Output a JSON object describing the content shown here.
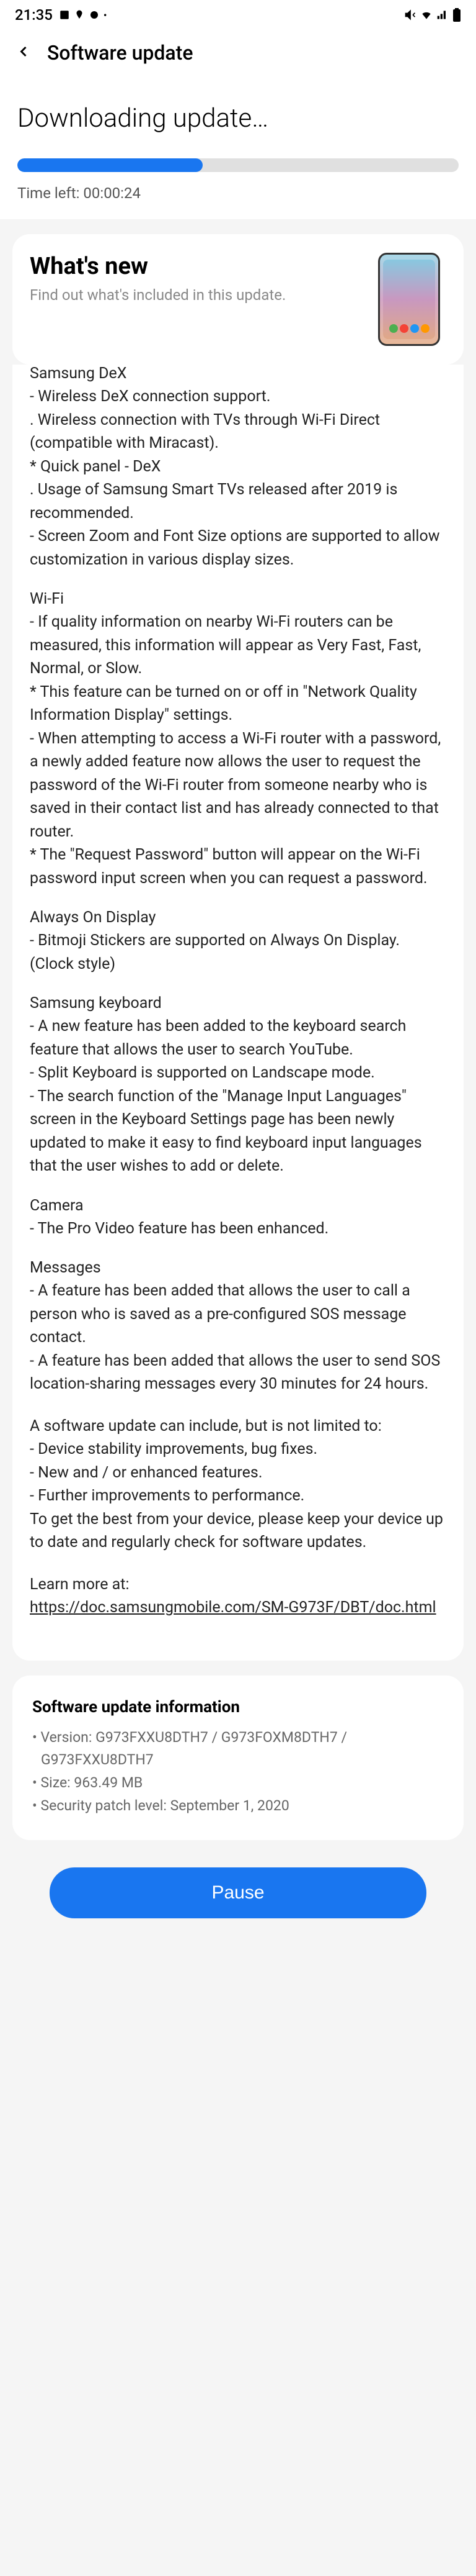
{
  "status": {
    "time": "21:35",
    "left_icons": "🖼 ☁ ⚙ •",
    "right_icons": "🔕 📶 📊 🔋"
  },
  "header": {
    "title": "Software update"
  },
  "download": {
    "title": "Downloading update…",
    "time_left": "Time left: 00:00:24",
    "progress_percent": 42
  },
  "whats_new": {
    "title": "What's new",
    "subtitle": "Find out what's included in this update."
  },
  "sections": [
    {
      "title": "Samsung DeX",
      "items": [
        " - Wireless DeX connection support.",
        "  . Wireless connection with TVs through Wi-Fi Direct (compatible with Miracast).",
        " * Quick panel - DeX",
        "  . Usage of Samsung Smart TVs released after 2019 is recommended.",
        " - Screen Zoom and Font Size options are supported to allow customization in various display sizes."
      ]
    },
    {
      "title": "Wi-Fi",
      "items": [
        " - If quality information on nearby Wi-Fi routers can be measured, this information will appear as Very Fast, Fast, Normal, or Slow.",
        "  * This feature can be turned on or off in \"Network Quality Information Display\" settings.",
        " - When attempting to access a Wi-Fi router with a password, a newly added feature now allows the user to request the password of the Wi-Fi router from someone nearby who is saved in their contact list and has already connected to that router.",
        "  * The \"Request Password\" button will appear on the Wi-Fi password input screen when you can request a password."
      ]
    },
    {
      "title": "Always On Display",
      "items": [
        " - Bitmoji Stickers are supported on Always On Display. (Clock style)"
      ]
    },
    {
      "title": "Samsung keyboard",
      "items": [
        " - A new feature has been added to the keyboard search feature that allows the user to search YouTube.",
        " - Split Keyboard is supported on Landscape mode.",
        " - The search function of the \"Manage Input Languages\" screen in the Keyboard Settings page has been newly updated to make it easy to find keyboard input languages that the user wishes to add or delete."
      ]
    },
    {
      "title": "Camera",
      "items": [
        " - The Pro Video feature has been enhanced."
      ]
    },
    {
      "title": "Messages",
      "items": [
        " - A feature has been added that allows the user to call a person who is saved as a pre-configured SOS message contact.",
        " - A feature has been added that allows the user to send SOS location-sharing messages every 30 minutes for 24 hours."
      ]
    },
    {
      "title": "",
      "items": [
        "A software update can include, but is not limited to:",
        "  - Device stability improvements, bug fixes.",
        "  - New and / or enhanced features.",
        "  - Further improvements to performance.",
        "To get the best from your device, please keep your device up to date and regularly check for software updates."
      ]
    }
  ],
  "learn_more": {
    "label": "Learn more at:",
    "url": "https://doc.samsungmobile.com/SM-G973F/DBT/doc.html"
  },
  "info": {
    "title": "Software update information",
    "version_label": "• Version: ",
    "version": "G973FXXU8DTH7 / G973FOXM8DTH7 / G973FXXU8DTH7",
    "size_label": "• Size: ",
    "size": "963.49 MB",
    "patch_label": "• Security patch level: ",
    "patch": "September 1, 2020"
  },
  "button": {
    "pause": "Pause"
  }
}
